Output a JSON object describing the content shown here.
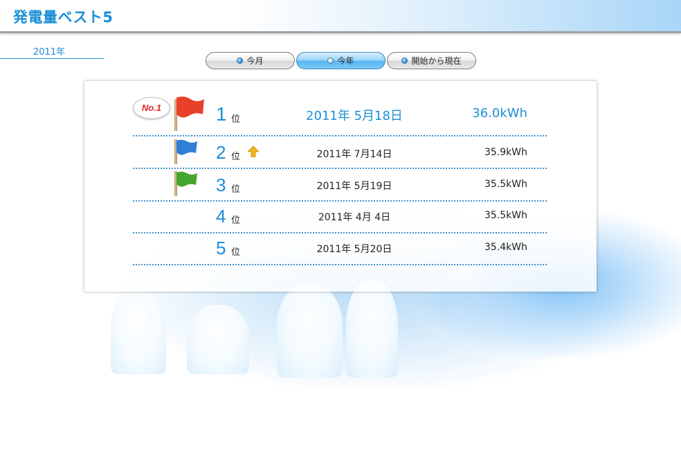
{
  "header": {
    "title": "発電量ベスト5"
  },
  "period": {
    "label": "2011年"
  },
  "tabs": [
    {
      "label": "今月",
      "active": false
    },
    {
      "label": "今年",
      "active": true
    },
    {
      "label": "開始から現在",
      "active": false
    }
  ],
  "badge": {
    "text": "No.1"
  },
  "rankings": [
    {
      "rank": "1",
      "suffix": "位",
      "date": "2011年 5月18日",
      "energy": "36.0kWh",
      "flag_color": "#e8402a",
      "trend": ""
    },
    {
      "rank": "2",
      "suffix": "位",
      "date": "2011年 7月14日",
      "energy": "35.9kWh",
      "flag_color": "#2f7fd6",
      "trend": "up"
    },
    {
      "rank": "3",
      "suffix": "位",
      "date": "2011年 5月19日",
      "energy": "35.5kWh",
      "flag_color": "#45a52e",
      "trend": ""
    },
    {
      "rank": "4",
      "suffix": "位",
      "date": "2011年 4月 4日",
      "energy": "35.5kWh",
      "flag_color": "",
      "trend": ""
    },
    {
      "rank": "5",
      "suffix": "位",
      "date": "2011年 5月20日",
      "energy": "35.4kWh",
      "flag_color": "",
      "trend": ""
    }
  ]
}
